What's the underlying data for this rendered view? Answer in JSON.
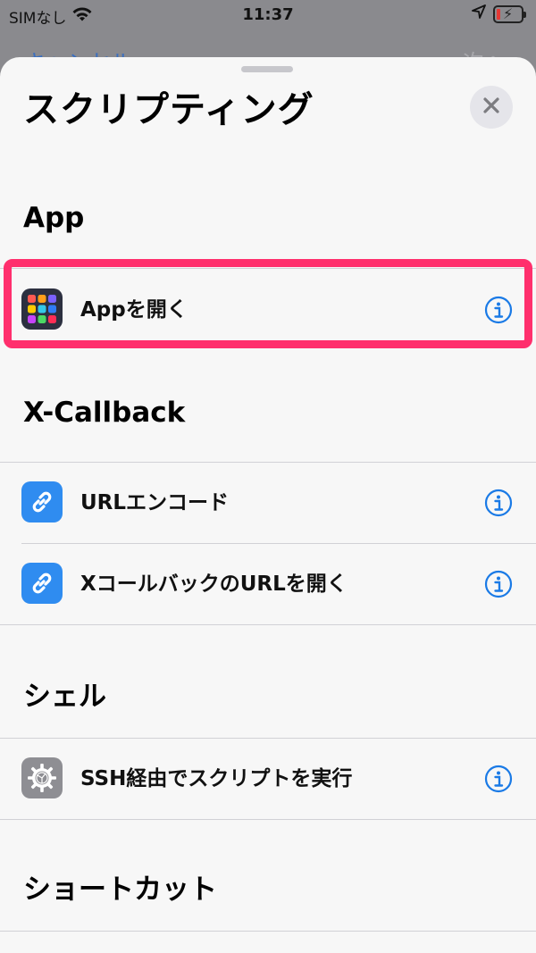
{
  "status_bar": {
    "carrier": "SIMなし",
    "time": "11:37"
  },
  "behind": {
    "cancel_label": "キャンセル",
    "next_label": "次へ"
  },
  "sheet": {
    "title": "スクリプティング",
    "sections": [
      {
        "header": "App",
        "items": [
          {
            "label": "Appを開く",
            "icon": "apps-grid-icon"
          }
        ]
      },
      {
        "header": "X-Callback",
        "items": [
          {
            "label": "URLエンコード",
            "icon": "link-icon"
          },
          {
            "label": "XコールバックのURLを開く",
            "icon": "link-icon"
          }
        ]
      },
      {
        "header": "シェル",
        "items": [
          {
            "label": "SSH経由でスクリプトを実行",
            "icon": "gear-icon"
          }
        ]
      },
      {
        "header": "ショートカット",
        "items": []
      }
    ]
  },
  "colors": {
    "highlight": "#ff2f6d",
    "accent": "#1a7ae6",
    "link_icon_bg": "#2f8cf0"
  }
}
